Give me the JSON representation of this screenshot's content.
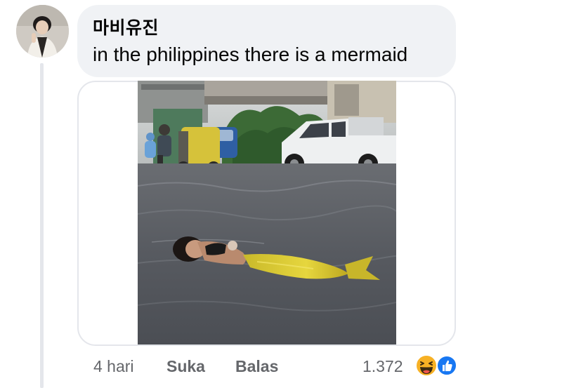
{
  "comment": {
    "author": "마비유진",
    "text": "in the philippines there is a mermaid",
    "avatar_icon": "user-avatar-photo",
    "attachment": {
      "type": "photo",
      "description_icon": "attached-photo"
    }
  },
  "actions": {
    "time": "4 hari",
    "like_label": "Suka",
    "reply_label": "Balas"
  },
  "reactions": {
    "count": "1.372",
    "icons": [
      "haha-reaction-icon",
      "like-reaction-icon"
    ],
    "colors": {
      "haha": "#f7b125",
      "like": "#1877f2"
    }
  },
  "theme": {
    "bubble_bg": "#f0f2f5",
    "secondary_text": "#65676b",
    "primary_text": "#050505"
  }
}
